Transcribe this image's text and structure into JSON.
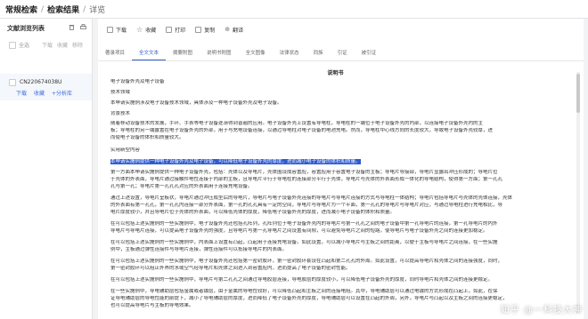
{
  "breadcrumb": {
    "home": "常规检索",
    "sep1": "/",
    "results": "检索结果",
    "sep2": "/",
    "current": "详览"
  },
  "sidebar": {
    "title": "文献浏览列表",
    "select_all": "全选",
    "ops": [
      "下载",
      "收藏",
      "移除"
    ],
    "doc": {
      "id": "CN220674038U",
      "links": [
        "下载",
        "收藏",
        "+分析库"
      ]
    }
  },
  "toolbar": [
    {
      "label": "下载",
      "icon": "download-icon"
    },
    {
      "label": "收藏",
      "icon": "star-icon"
    },
    {
      "label": "打印",
      "icon": "print-icon"
    },
    {
      "label": "复制",
      "icon": "copy-icon"
    },
    {
      "label": "翻译",
      "icon": "translate-icon"
    }
  ],
  "tabs": [
    "著录项目",
    "全文文本",
    "摘要附图",
    "说明书附图",
    "全文图像",
    "法律状态",
    "同族",
    "引证",
    "被引证"
  ],
  "active_tab": "全文文本",
  "document": {
    "title": "说明书",
    "lines": [
      "电子设备外壳及电子设备",
      "技术领域",
      "本申请实施例涉及电子设备技术领域，具体涉及一种电子设备外壳及电子设备。",
      "背景技术",
      "随着移动设备技术的发展，手环、手表等电子设备逐渐得到普遍的应用。电子设备外壳上设置有导电柱，导电柱的一端位于电子设备外壳的内部，以连接电子设备外壳内的主",
      "板；导电柱的另一端露置在电子设备外壳的外部，用于与充电设备连接，以通过导电柱对电子设备的电池充电。然而，导电柱中心线方向的长度较大，导致电子设备外壳较厚，进",
      "而使电子设备的体积和质量较大。",
      "实用新型内容",
      "本申请实施例提供一种电子设备外壳及电子设备，可以降低电子设备外壳的厚度，进而减小电子设备的体积和质量。",
      "第一方面本申请实施例提供一种电子设备外壳，包括：壳体以及导电片，壳体围设成容置腔，容置腔用于容置电子设备的主板；导电片导接部，导电片显露出冲压形成的；导电片位",
      "于壳体的外表面，导电片通过接触件电性连接于内部的主板，且导电片平行于导电柱的连接部分平行于壳体，导电片与壳体的外表面形成一体化的导电结构，使得第一方面；第一孔孔",
      "孔与第一孔；导电片第一孔孔孔对应的外表面用于连接充电设备。",
      "通过上述设置，导电片呈板状，导电片通过冲压成型后的导电片，导电片与电子设备外壳连接的导电片与导电片连接的方式与导电柱一体结构；导电片包括导电片与壳体的壳体连接，壳体",
      "的外表面有第一孔孔，第一孔孔内连接一部分外表面，第一孔的孔孔具有一定的空间，导电片与导电片为一个平面，第一孔孔的导电片与导电片对应，与通过导电柱进行充电相比，导",
      "电片厚度较小，并且导电片位于壳体的外表面，可以降低壳体的厚度，降低电子设备外壳的厚度，进而减小电子设备的体积和质量。",
      "在可以包括上述实施例的一些实施例中，电子设备外壳还包括孔阵列，孔阵列位于电子设备外壳内的导电片与第一孔孔之间的电子设备中第一孔导电片的连接，第一孔导电片的内外",
      "导电片与导电片连接，可以提高电子设备外壳的强度，且导电片与第一孔导电片之间设置有间隙，可以避免导电片之间的短路，使导电片与电子设备外壳之间的连接更加稳定。",
      "在可以包括上述实施例的一些实施例中，内表面上设置有凸起，凸起用于连接充电设备。如此设置，可以减小导电片与主板之间的距离，以便于主板与导电片之间连接，在一些实施",
      "例中，主板通过弹性连接件与导电片连接，弹性连接件可以抵接导电片的内表面。",
      "在可以包括上述实施例的一些实施例中，电子设备外壳还包括第一密封胶环，第一密封胶环套设在凸起和第二孔孔的外周。如此设置，可以提高导电片和壳体之间的连接强度，同时，",
      "第一密封胶环可以阻止外界的水或空气经导电片和壳体之间进入到容置腔内，进而提高了电子设备的密封性能。",
      "在可以包括上述实施例的一些实施例中，导电片与第二孔孔之间通过导电胶层连接，导电胶层的厚度较小，可以降低电子设备外壳的厚度，同时导电片和壳体之间的连接更稳定。",
      "在一些实施例中，导电辅助层包括金属或者镀层，由于金属的导电性较好，可以降低凸起和主板之间的连接电阻。其中，导电辅助层可以通过电镀的方式形成在凸起上，如此，在保",
      "证导电辅助层的导电性能的前提下，减小了导电辅助层的厚度，进而降低了电子设备外壳的厚度，导电辅助层可以设置在凸起的外周，另外，导电片与凸起以及主板之间的连接更稳定，",
      "也可以提高导电片与主板的导电效果。"
    ]
  },
  "watermark": "知乎 @一科技大神"
}
